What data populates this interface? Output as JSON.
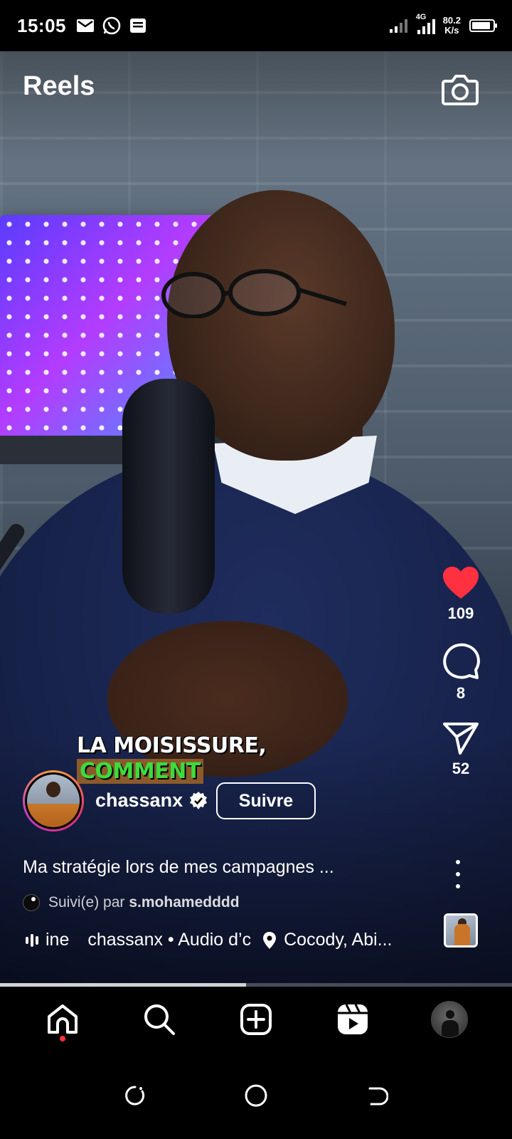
{
  "status_bar": {
    "time": "15:05",
    "network_type": "4G",
    "speed_value": "80.2",
    "speed_unit": "K/s",
    "battery_level": 0.9,
    "notification_icons": [
      "gmail-icon",
      "whatsapp-icon",
      "message-icon"
    ]
  },
  "header": {
    "title": "Reels",
    "camera_icon": "camera-icon"
  },
  "video": {
    "caption_line1": "LA MOISISSURE,",
    "caption_line2": "COMMENT",
    "progress": 0.48
  },
  "actions": {
    "likes": "109",
    "comments": "8",
    "shares": "52",
    "like_color": "#ff3040"
  },
  "post": {
    "username": "chassanx",
    "follow_label": "Suivre",
    "description": "Ma stratégie lors de mes campagnes ...",
    "followed_prefix": "Suivi(e) par",
    "followed_user": "s.mohamedddd",
    "audio_text_a": "ine",
    "audio_text_b": "chassanx • Audio d’c",
    "location": "Cocody, Abi..."
  },
  "nav": {
    "items": [
      "home-icon",
      "search-icon",
      "create-icon",
      "reels-icon",
      "profile-avatar"
    ],
    "active": "home",
    "notification_dot_color": "#ff3040"
  },
  "system_nav": [
    "recents-button",
    "home-button",
    "back-button"
  ]
}
